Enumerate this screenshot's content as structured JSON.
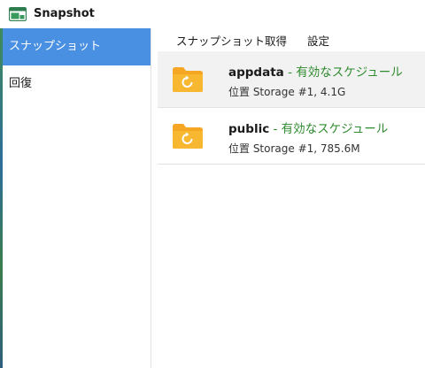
{
  "window": {
    "title": "Snapshot",
    "app_icon": "snapshot-app-icon"
  },
  "sidebar": {
    "items": [
      {
        "label": "スナップショット",
        "active": true
      },
      {
        "label": "回復",
        "active": false
      }
    ]
  },
  "toolbar": {
    "take_snapshot_label": "スナップショット取得",
    "settings_label": "設定"
  },
  "snapshots": [
    {
      "name": "appdata",
      "separator": " - ",
      "status": "有効なスケジュール",
      "location": "位置 Storage #1, 4.1G",
      "icon": "folder-restore-icon",
      "selected": true
    },
    {
      "name": "public",
      "separator": " - ",
      "status": "有効なスケジュール",
      "location": "位置 Storage #1, 785.6M",
      "icon": "folder-restore-icon",
      "selected": false
    }
  ],
  "colors": {
    "accent": "#4a90e2",
    "status_green": "#2e8b2e",
    "folder": "#f5a623"
  }
}
